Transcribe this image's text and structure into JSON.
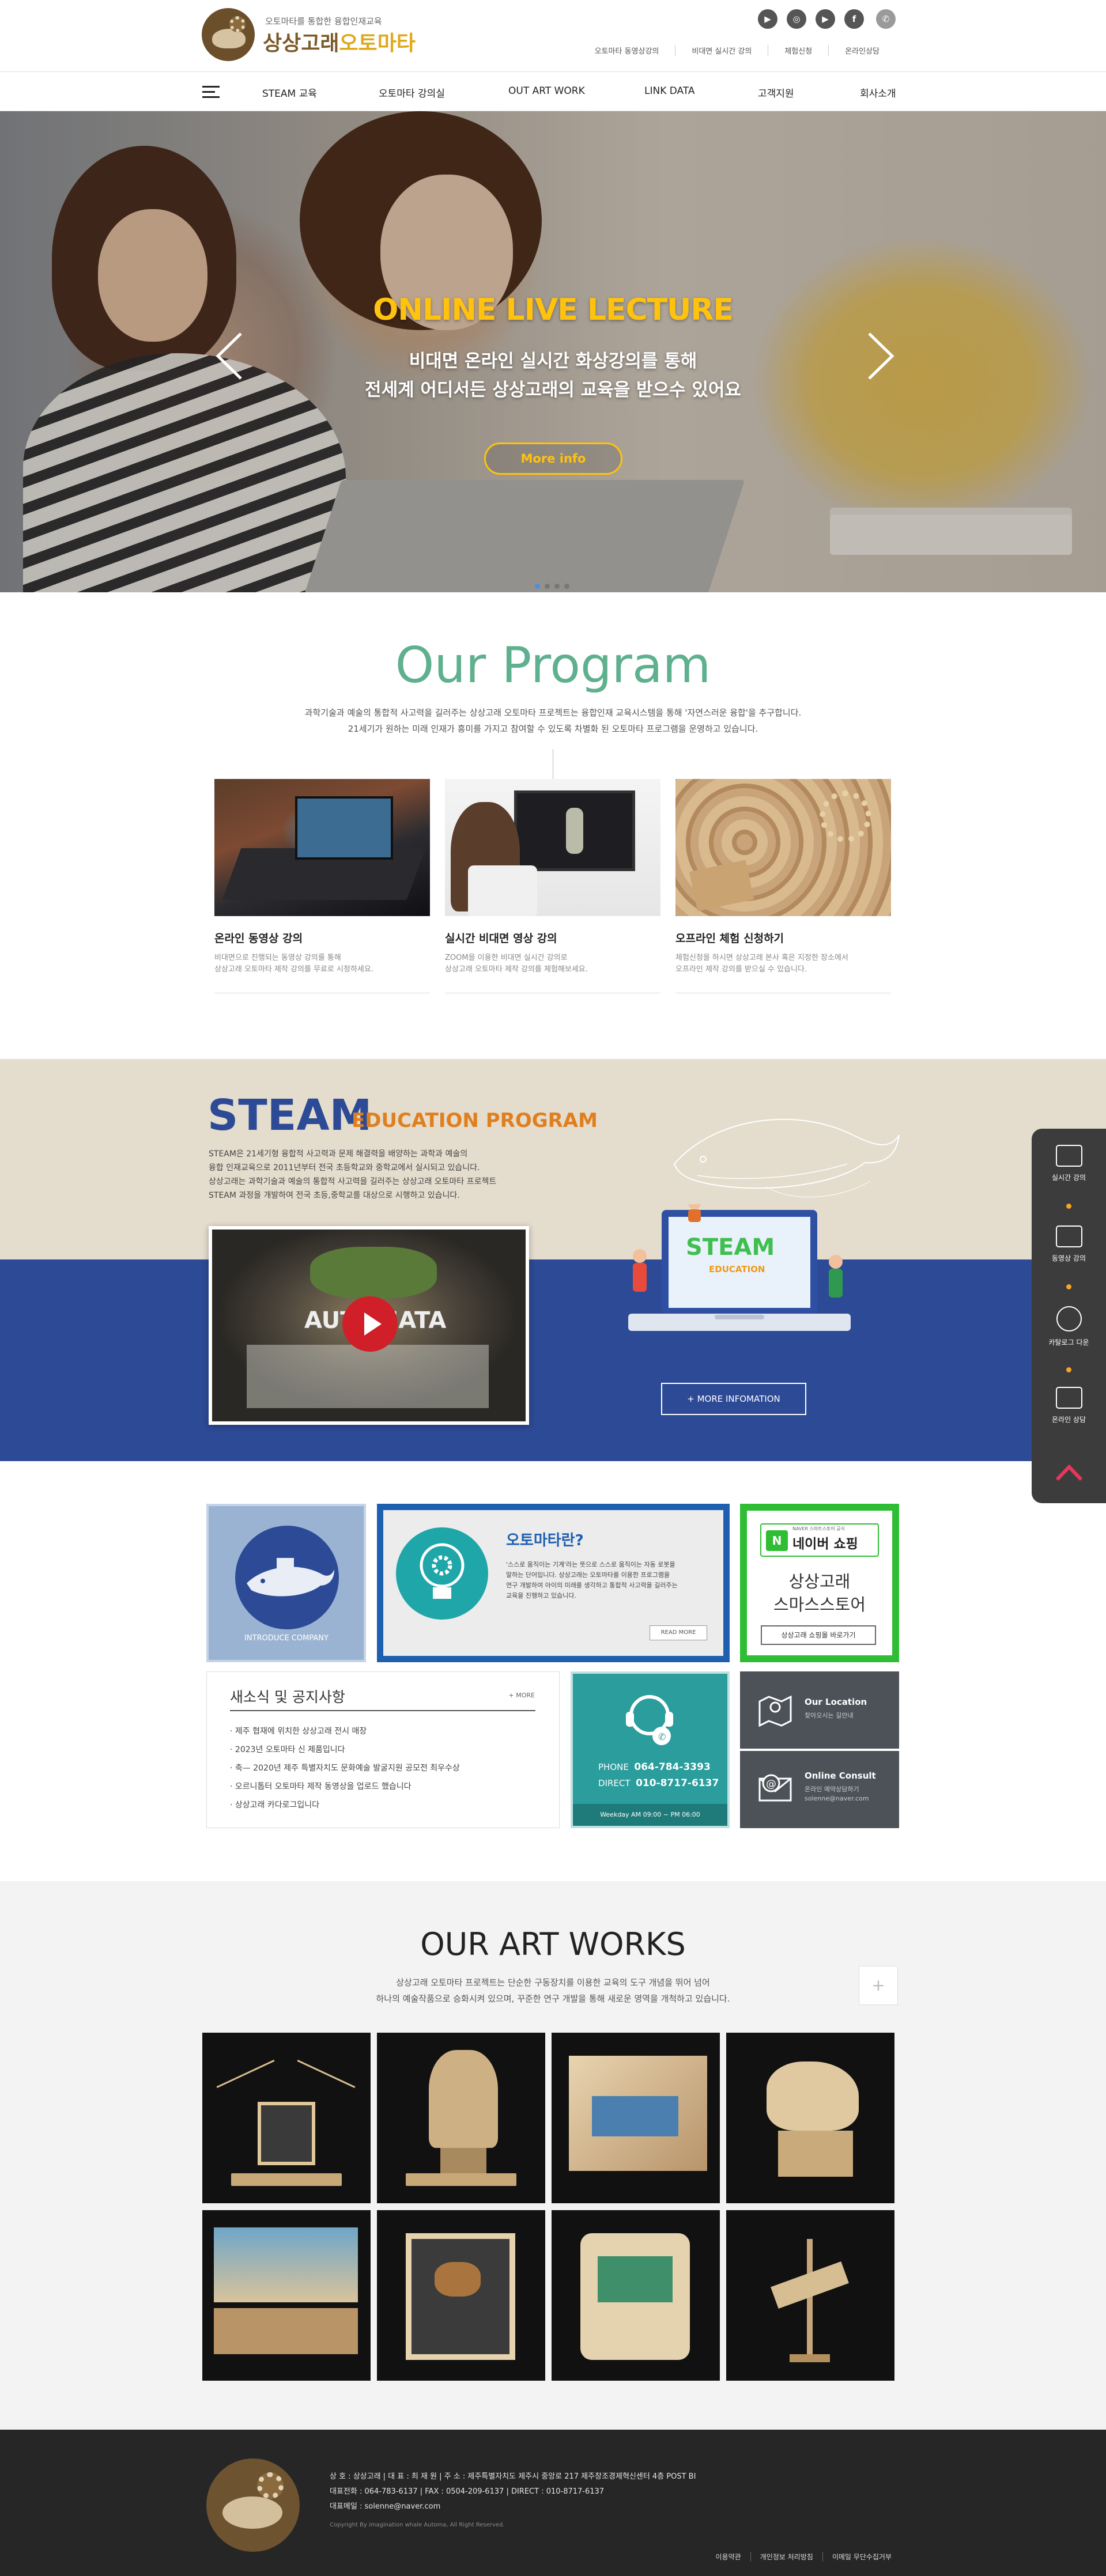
{
  "header": {
    "logo_sub": "오토마타를 통합한 융합인재교육",
    "logo_main_a": "상상고래",
    "logo_main_b": "오토마타",
    "sns": [
      {
        "icon": "video-icon",
        "glyph": "▶"
      },
      {
        "icon": "instagram-icon",
        "glyph": "◎"
      },
      {
        "icon": "youtube-icon",
        "glyph": "▶"
      },
      {
        "icon": "facebook-icon",
        "glyph": "f"
      },
      {
        "icon": "kakao-icon",
        "glyph": "✆"
      }
    ],
    "util_links": [
      "오토마타 동영상강의",
      "비대면 실시간 강의",
      "체험신청",
      "온라인상담"
    ]
  },
  "nav": {
    "items": [
      "STEAM 교육",
      "오토마타 강의실",
      "OUT ART WORK",
      "LINK DATA",
      "고객지원",
      "회사소개"
    ]
  },
  "hero": {
    "title": "ONLINE LIVE LECTURE",
    "line1": "비대면 온라인 실시간 화상강의를 통해",
    "line2": "전세계 어디서든 상상고래의 교육을 받으수 있어요",
    "button": "More info",
    "slide_count": 4,
    "active_slide": 1
  },
  "program": {
    "title": "Our Program",
    "desc1": "과학기술과 예술의 통합적 사고력을 길러주는 상상고래 오토마타 프로젝트는 융합인재 교육시스템을 통해 '자연스러운 융합'을 추구합니다.",
    "desc2": "21세기가 원하는 미래 인재가 흥미를 가지고 참여할 수 있도록 차별화 된 오토마타 프로그램을 운영하고 있습니다.",
    "cards": [
      {
        "title": "온라인 동영상 강의",
        "text1": "비대면으로 진행되는 동영상 강의를 통해",
        "text2": "상상고래 오토마타 제작 강의를 무료로 시청하세요."
      },
      {
        "title": "실시간 비대면 영상 강의",
        "text1": "ZOOM을 이용한 비대면 실시간 강의로",
        "text2": "상상고래 오토마타 제작 강의를 체험해보세요."
      },
      {
        "title": "오프라인 체험 신청하기",
        "text1": "체험신청을 하시면 상상고래 본사 혹은 지정한 장소에서",
        "text2": "오프라인 제작 강의를 받으실 수 있습니다."
      }
    ]
  },
  "steam": {
    "title": "STEAM",
    "subtitle": "EDUCATION PROGRAM",
    "p1": "STEAM은 21세기형 융합적 사고력과 문제 해결력을 배양하는 과학과 예술의",
    "p2": "융합 인재교육으로 2011년부터 전국 초등학교와 중학교에서 실시되고 있습니다.",
    "p3": "상상고래는 과학기술과 예술의 통합적 사고력을 길러주는 상상고래 오토마타 프로젝트",
    "p4": "STEAM 과정을 개발하여 전국 초등,중학교를 대상으로 시행하고 있습니다.",
    "video_text": "AUTOMATA",
    "laptop_text": "STEAM",
    "laptop_sub": "EDUCATION",
    "more_button": "+ MORE INFOMATION"
  },
  "quick": {
    "items": [
      {
        "label": "실시간 강의",
        "icon": "live-lecture-icon"
      },
      {
        "label": "동영상 강의",
        "icon": "video-lecture-icon"
      },
      {
        "label": "카탈로그 다운",
        "icon": "download-icon"
      },
      {
        "label": "온라인 상담",
        "icon": "consult-icon"
      }
    ],
    "top_icon": "chevron-up-icon"
  },
  "boxes": {
    "intro_label": "INTRODUCE COMPANY",
    "what_title": "오토마타란?",
    "what_p1": "'스스로 움직이는 기계'라는 뜻으로 스스로 움직이는 자동 로봇을",
    "what_p2": "말하는 단어입니다. 상상고래는 오토마타를 이용한 프로그램을",
    "what_p3": "연구 개발하여 아이의 미래를 생각하고 통합적 사고력을 길러주는",
    "what_p4": "교육을 진행하고 있습니다.",
    "what_more": "READ MORE",
    "naver_small": "NAVER 스마트스토어 공식",
    "naver_n": "N",
    "naver_shop": "네이버 쇼핑",
    "naver_name1": "상상고래",
    "naver_name2": "스마스스토어",
    "naver_btn": "상상고래 쇼핑몰 바로가기",
    "news_title": "새소식 및 공지사항",
    "news_more": "+ MORE",
    "news_items": [
      "제주 협재에 위치한 상상고래 전시 매장",
      "2023년 오토마타 신 제품입니다",
      "축— 2020년 제주 특별자치도 문화예술 발굴지원 공모전 최우수상",
      "오르니톱터 오토마타 제작 동영상을 업로드 했습니다",
      "상상고래 카다로그입니다"
    ],
    "phone_label": "PHONE",
    "phone": "064-784-3393",
    "direct_label": "DIRECT",
    "direct": "010-8717-6137",
    "hours": "Weekday AM 09:00 ~ PM 06:00",
    "loc_title": "Our Location",
    "loc_sub": "찾아오시는 길안내",
    "consult_title": "Online Consult",
    "consult_sub1": "온라인 예약상담하기",
    "consult_sub2": "solenne@naver.com"
  },
  "art": {
    "title": "OUR ART WORKS",
    "desc1": "상상고래 오토마타 프로젝트는 단순한 구동장치를 이용한 교육의 도구 개념을 뛰어 넘어",
    "desc2": "하나의 예술작품으로 승화시켜 있으며, 꾸준한 연구 개발을 통해 새로운 영역을 개척하고 있습니다.",
    "plus": "+"
  },
  "footer": {
    "line1": "상 호 : 상상고래   |   대 표 : 최 재 원   |   주 소 : 제주특별자치도 제주시 중앙로 217 제주창조경제혁신센터 4층 POST BI",
    "line2": "대표전화 : 064-783-6137   |   FAX : 0504-209-6137   |   DIRECT : 010-8717-6137",
    "line3": "대표메일 : solenne@naver.com",
    "copy": "Copyright By imagination whale Automa, All Right Reserved.",
    "links": [
      "이용약관",
      "개인정보 처리방침",
      "이메일 무단수집거부"
    ]
  },
  "colors": {
    "program_green": "#5fb08e",
    "steam_blue": "#2d4a96",
    "steam_orange": "#e07f1e",
    "hero_yellow": "#ffc20e",
    "naver_green": "#2fbd34",
    "phone_teal": "#2a9d9c"
  }
}
